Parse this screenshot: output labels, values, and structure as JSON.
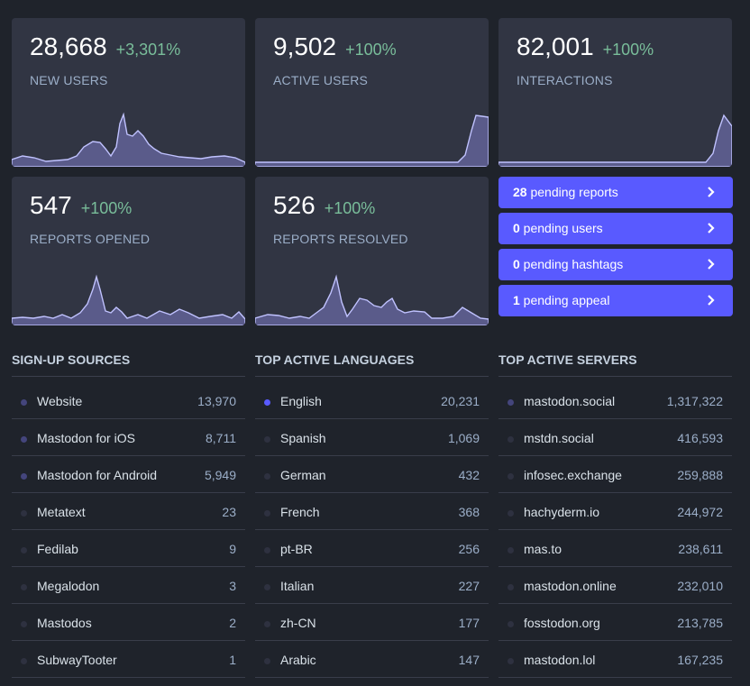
{
  "cards": [
    {
      "value": "28,668",
      "change": "+3,301%",
      "label": "NEW USERS"
    },
    {
      "value": "9,502",
      "change": "+100%",
      "label": "ACTIVE USERS"
    },
    {
      "value": "82,001",
      "change": "+100%",
      "label": "INTERACTIONS"
    },
    {
      "value": "547",
      "change": "+100%",
      "label": "REPORTS OPENED"
    },
    {
      "value": "526",
      "change": "+100%",
      "label": "REPORTS RESOLVED"
    }
  ],
  "pending": [
    {
      "count": "28",
      "text": " pending reports"
    },
    {
      "count": "0",
      "text": " pending users"
    },
    {
      "count": "0",
      "text": " pending hashtags"
    },
    {
      "count": "1",
      "text": " pending appeal"
    }
  ],
  "colors": {
    "dot_bright": "#595aff",
    "dot_mid": "#44457c",
    "dot_dim": "#2e3140",
    "accent": "#595aff",
    "positive": "#79bd9a"
  },
  "signup": {
    "title": "SIGN-UP SOURCES",
    "rows": [
      {
        "name": "Website",
        "value": "13,970",
        "dot": "mid"
      },
      {
        "name": "Mastodon for iOS",
        "value": "8,711",
        "dot": "mid"
      },
      {
        "name": "Mastodon for Android",
        "value": "5,949",
        "dot": "mid"
      },
      {
        "name": "Metatext",
        "value": "23",
        "dot": "dim"
      },
      {
        "name": "Fedilab",
        "value": "9",
        "dot": "dim"
      },
      {
        "name": "Megalodon",
        "value": "3",
        "dot": "dim"
      },
      {
        "name": "Mastodos",
        "value": "2",
        "dot": "dim"
      },
      {
        "name": "SubwayTooter",
        "value": "1",
        "dot": "dim"
      }
    ]
  },
  "languages": {
    "title": "TOP ACTIVE LANGUAGES",
    "rows": [
      {
        "name": "English",
        "value": "20,231",
        "dot": "bright"
      },
      {
        "name": "Spanish",
        "value": "1,069",
        "dot": "dim"
      },
      {
        "name": "German",
        "value": "432",
        "dot": "dim"
      },
      {
        "name": "French",
        "value": "368",
        "dot": "dim"
      },
      {
        "name": "pt-BR",
        "value": "256",
        "dot": "dim"
      },
      {
        "name": "Italian",
        "value": "227",
        "dot": "dim"
      },
      {
        "name": "zh-CN",
        "value": "177",
        "dot": "dim"
      },
      {
        "name": "Arabic",
        "value": "147",
        "dot": "dim"
      }
    ]
  },
  "servers": {
    "title": "TOP ACTIVE SERVERS",
    "rows": [
      {
        "name": "mastodon.social",
        "value": "1,317,322",
        "dot": "mid"
      },
      {
        "name": "mstdn.social",
        "value": "416,593",
        "dot": "dim"
      },
      {
        "name": "infosec.exchange",
        "value": "259,888",
        "dot": "dim"
      },
      {
        "name": "hachyderm.io",
        "value": "244,972",
        "dot": "dim"
      },
      {
        "name": "mas.to",
        "value": "238,611",
        "dot": "dim"
      },
      {
        "name": "mastodon.online",
        "value": "232,010",
        "dot": "dim"
      },
      {
        "name": "fosstodon.org",
        "value": "213,785",
        "dot": "dim"
      },
      {
        "name": "mastodon.lol",
        "value": "167,235",
        "dot": "dim"
      }
    ]
  }
}
